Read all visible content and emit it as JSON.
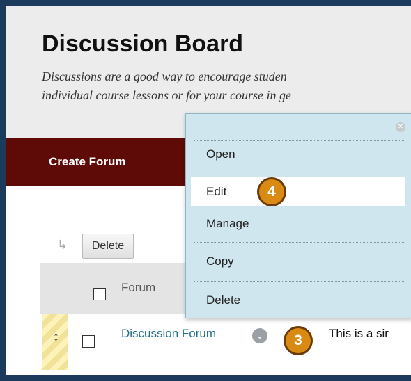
{
  "page": {
    "title": "Discussion Board",
    "description_line1": "Discussions are a good way to encourage studen",
    "description_line2": "individual course lessons or for your course in ge"
  },
  "toolbar": {
    "create_forum_label": "Create Forum"
  },
  "actions": {
    "delete_label": "Delete"
  },
  "table": {
    "header": {
      "forum_label": "Forum"
    },
    "rows": [
      {
        "forum_name": "Discussion Forum",
        "description": "This is a sir"
      }
    ]
  },
  "context_menu": {
    "items": [
      {
        "label": "Open"
      },
      {
        "label": "Edit"
      },
      {
        "label": "Manage"
      },
      {
        "label": "Copy"
      },
      {
        "label": "Delete"
      }
    ]
  },
  "callouts": {
    "step3": "3",
    "step4": "4"
  },
  "icons": {
    "close": "close-icon",
    "chevron": "chevron-down-icon",
    "handle": "drag-handle-icon",
    "arrow": "arrow-icon"
  },
  "colors": {
    "create_forum_bg": "#5e0a07",
    "menu_bg": "#cfe6ee",
    "badge": "#d88a12",
    "link": "#1f6f8b"
  }
}
